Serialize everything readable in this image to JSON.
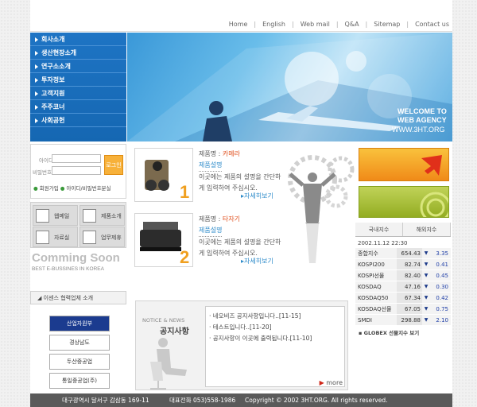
{
  "topnav": {
    "links": [
      "Home",
      "English",
      "Web mail",
      "Q&A",
      "Sitemap",
      "Contact us"
    ]
  },
  "menu": {
    "items": [
      "회사소개",
      "생산현장소개",
      "연구소소개",
      "투자정보",
      "고객지원",
      "주주코너",
      "사회공헌"
    ]
  },
  "hero": {
    "welcome1": "WELCOME TO",
    "welcome2": "WEB AGENCY",
    "url": "WWW.3HT.ORG"
  },
  "login": {
    "id_label": "아이디",
    "pw_label": "비밀번호",
    "button": "로그인",
    "join": "회원가입",
    "find": "아이디/비밀번호분실"
  },
  "quick": {
    "items": [
      "웹메일",
      "제품소개",
      "자료실",
      "업무제휴"
    ]
  },
  "promo": {
    "title": "Comming Soon",
    "subtitle": "BEST E-BUSSINES IN KOREA"
  },
  "partners": {
    "header": "이센스 협력업체 소개",
    "items": [
      "산업자원부",
      "경상남도",
      "두산중공업",
      "통일중공업(주)"
    ]
  },
  "products": [
    {
      "name_label": "제품명",
      "name": "카메라",
      "desc_title": "제품설명",
      "desc": "이곳에는 제품의 설명을 간단하게 입력하여 주십시오.",
      "more": "자세히보기",
      "num": "1"
    },
    {
      "name_label": "제품명",
      "name": "타자기",
      "desc_title": "제품설명",
      "desc": "이곳에는 제품의 설명을 간단하게 입력하여 주십시오.",
      "more": "자세히보기",
      "num": "2"
    }
  ],
  "stock": {
    "tabs": [
      "국내지수",
      "해외지수"
    ],
    "date": "2002.11.12 22:30",
    "rows": [
      {
        "name": "종합지수",
        "value": "654.43",
        "change": "3.35"
      },
      {
        "name": "KOSPI200",
        "value": "82.74",
        "change": "0.41"
      },
      {
        "name": "KOSPI선물",
        "value": "82.40",
        "change": "0.45"
      },
      {
        "name": "KOSDAQ",
        "value": "47.16",
        "change": "0.30"
      },
      {
        "name": "KOSDAQ50",
        "value": "67.34",
        "change": "0.42"
      },
      {
        "name": "KOSDAQ선물",
        "value": "67.05",
        "change": "0.75"
      },
      {
        "name": "SMDI",
        "value": "298.88",
        "change": "2.10"
      }
    ],
    "footer": "GLOBEX 선물지수 보기"
  },
  "notice": {
    "label_en": "NOTICE & NEWS",
    "title": "공지사항",
    "items": [
      "네오비즈 공지사항입니다..[11-15]",
      "테스트입니다..[11-20]",
      "공지사항이 이곳에 출력됩니다.[11-10]"
    ],
    "more": "more"
  },
  "footer": {
    "address": "대구광역시 달서구 감삼동 169-11",
    "phone": "대표전화 053)558-1986",
    "copyright": "Copyright © 2002 3HT.ORG. All rights reserved."
  },
  "colors": {
    "menu_blue": "#1e74c4",
    "accent_orange": "#f08a18",
    "accent_green": "#93ad22",
    "link_blue": "#2b8ac9",
    "product_red": "#e0501e"
  }
}
